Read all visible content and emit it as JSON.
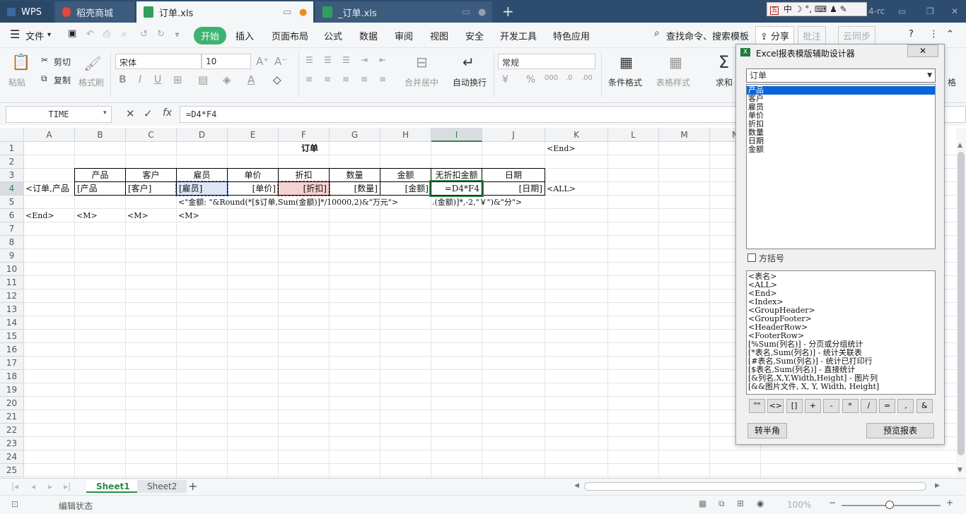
{
  "tabs": [
    {
      "label": "WPS"
    },
    {
      "label": "稻壳商城"
    },
    {
      "label": "订单.xls"
    },
    {
      "label": "_订单.xls"
    }
  ],
  "ime": {
    "label": "中",
    "suffix": "4-rc"
  },
  "menu": {
    "file": "文件",
    "items": [
      "开始",
      "插入",
      "页面布局",
      "公式",
      "数据",
      "审阅",
      "视图",
      "安全",
      "开发工具",
      "特色应用"
    ],
    "search": "查找命令、搜索模板",
    "share": "分享",
    "review": "批注",
    "sync": "云同步"
  },
  "ribbon": {
    "paste": "粘贴",
    "cut": "剪切",
    "copy": "复制",
    "format_painter": "格式刷",
    "font": "宋体",
    "size": "10",
    "number_format": "常规",
    "merge": "合并居中",
    "wrap": "自动换行",
    "cond_format": "条件格式",
    "table_style": "表格样式",
    "sum": "求和",
    "cell_fmt": "格"
  },
  "formula_bar": {
    "name": "TIME",
    "formula": "=D4*F4",
    "fx": "fx"
  },
  "columns": [
    "A",
    "B",
    "C",
    "D",
    "E",
    "F",
    "G",
    "H",
    "I",
    "J",
    "K",
    "L",
    "M",
    "N"
  ],
  "rows": [
    "1",
    "2",
    "3",
    "4",
    "5",
    "6",
    "7",
    "8",
    "9",
    "10",
    "11",
    "12",
    "13",
    "14",
    "15",
    "16",
    "17",
    "18",
    "19",
    "20",
    "21",
    "22",
    "23",
    "24",
    "25"
  ],
  "cells": {
    "title": "订单",
    "k1": "<End>",
    "headers": [
      "产品",
      "客户",
      "雇员",
      "单价",
      "折扣",
      "数量",
      "金额",
      "无折扣金额",
      "日期"
    ],
    "a4": "<订单,产品",
    "row4": [
      "[产品",
      "[客户]",
      "[雇员]",
      "[单价]",
      "[折扣]",
      "[数量]",
      "[金额]",
      "=D4*F4",
      "[日期]"
    ],
    "k4": "<ALL>",
    "d5": "<\"金额: \"&Round(*[$订单,Sum(金额)]*/10000,2)&\"万元\">",
    "i5": ".(金额)]*,-2,\"￥\")&\"分\">",
    "row6": [
      "<End>",
      "<M>",
      "<M>",
      "<M>"
    ]
  },
  "sheets": {
    "tabs": [
      "Sheet1",
      "Sheet2"
    ],
    "active": "Sheet1"
  },
  "status": {
    "mode": "编辑状态",
    "zoom": "100%"
  },
  "dialog": {
    "title": "Excel报表模版辅助设计器",
    "table_select": "订单",
    "fields": [
      "产品",
      "客户",
      "雇员",
      "单价",
      "折扣",
      "数量",
      "日期",
      "金额"
    ],
    "selected_field": "产品",
    "bracket_label": "方括号",
    "snippets": [
      "<表名>",
      "<ALL>",
      "<End>",
      "<Index>",
      "<GroupHeader>",
      "<GroupFooter>",
      "<HeaderRow>",
      "<FooterRow>",
      "[%Sum(列名)] - 分页或分组统计",
      "[*表名,Sum(列名)] - 统计关联表",
      "[#表名,Sum(列名)] - 统计已打印行",
      "[$表名,Sum(列名)] - 直接统计",
      "[&列名,X,Y,Width,Height] - 图片列",
      "[&&图片文件, X, Y, Width, Height]"
    ],
    "symbols": [
      "\"\"",
      "<>",
      "[]",
      "+",
      "-",
      "*",
      "/",
      "=",
      ",",
      "&"
    ],
    "btn_half": "转半角",
    "btn_preview": "预览报表"
  }
}
